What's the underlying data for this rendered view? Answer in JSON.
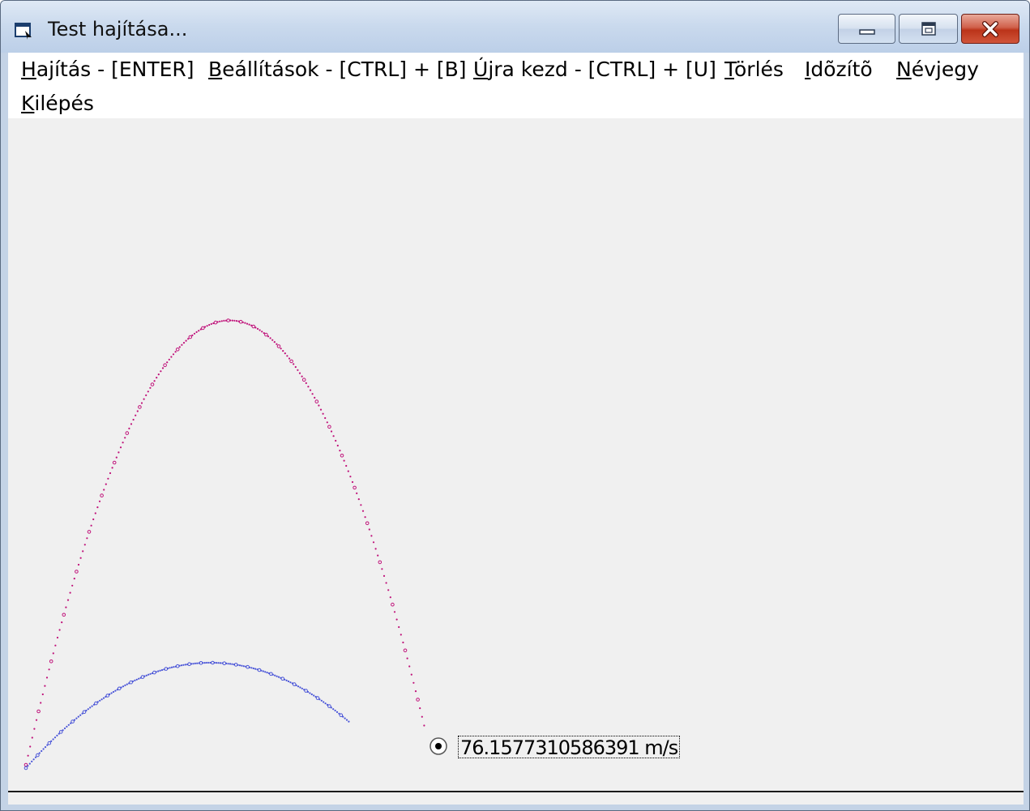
{
  "window": {
    "title": "Test hajítása..."
  },
  "menu": [
    {
      "accel": "H",
      "rest": "ajítás - [ENTER]"
    },
    {
      "accel": "B",
      "rest": "eállítások - [CTRL] + [B]"
    },
    {
      "accel": "Ú",
      "rest": "jra kezd - [CTRL] + [U]"
    },
    {
      "accel": "T",
      "rest": "örlés"
    },
    {
      "accel": "I",
      "rest": "dõzítõ"
    },
    {
      "accel": "N",
      "rest": "évjegy"
    },
    {
      "accel": "K",
      "rest": "ilépés"
    }
  ],
  "result": {
    "speed_text": "76.1577310586391 m/s",
    "option_selected": true
  },
  "trajectories": {
    "colors": {
      "pink": "#c0127a",
      "blue": "#4a55d8"
    }
  },
  "icons": {
    "app": "window-icon",
    "minimize": "minimize-icon",
    "maximize": "maximize-icon",
    "close": "close-icon"
  }
}
